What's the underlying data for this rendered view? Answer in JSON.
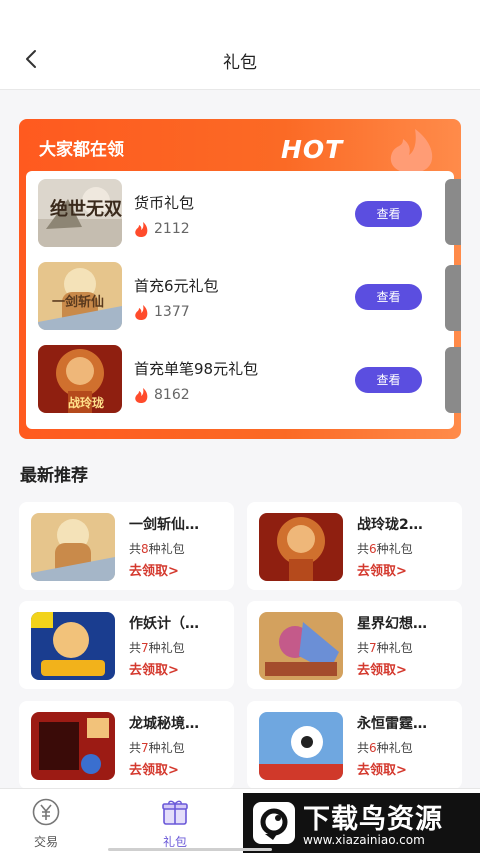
{
  "header": {
    "title": "礼包"
  },
  "hot": {
    "title": "大家都在领",
    "badge": "HOT",
    "view_label": "查看",
    "items": [
      {
        "name": "货币礼包",
        "count": "2112",
        "art": "绝世无双"
      },
      {
        "name": "首充6元礼包",
        "count": "1377",
        "art": "一剑斩仙"
      },
      {
        "name": "首充单笔98元礼包",
        "count": "8162",
        "art": "战玲珑"
      }
    ]
  },
  "section": {
    "title": "最新推荐"
  },
  "cards": [
    {
      "name": "一剑斩仙…",
      "prefix": "共",
      "num": "8",
      "suffix": "种礼包",
      "action": "去领取>"
    },
    {
      "name": "战玲珑2…",
      "prefix": "共",
      "num": "6",
      "suffix": "种礼包",
      "action": "去领取>"
    },
    {
      "name": "作妖计（…",
      "prefix": "共",
      "num": "7",
      "suffix": "种礼包",
      "action": "去领取>"
    },
    {
      "name": "星界幻想…",
      "prefix": "共",
      "num": "7",
      "suffix": "种礼包",
      "action": "去领取>"
    },
    {
      "name": "龙城秘境…",
      "prefix": "共",
      "num": "7",
      "suffix": "种礼包",
      "action": "去领取>"
    },
    {
      "name": "永恒雷霆…",
      "prefix": "共",
      "num": "6",
      "suffix": "种礼包",
      "action": "去领取>"
    }
  ],
  "tabbar": {
    "items": [
      {
        "label": "交易",
        "icon": "yen-coin-icon"
      },
      {
        "label": "礼包",
        "icon": "gift-icon"
      }
    ]
  },
  "watermark": {
    "title": "下载鸟资源",
    "url": "www.xiazainiao.com"
  },
  "colors": {
    "accent": "#5b4ee0",
    "hot_bg": "#ff5a1f",
    "link_red": "#d4392e"
  }
}
